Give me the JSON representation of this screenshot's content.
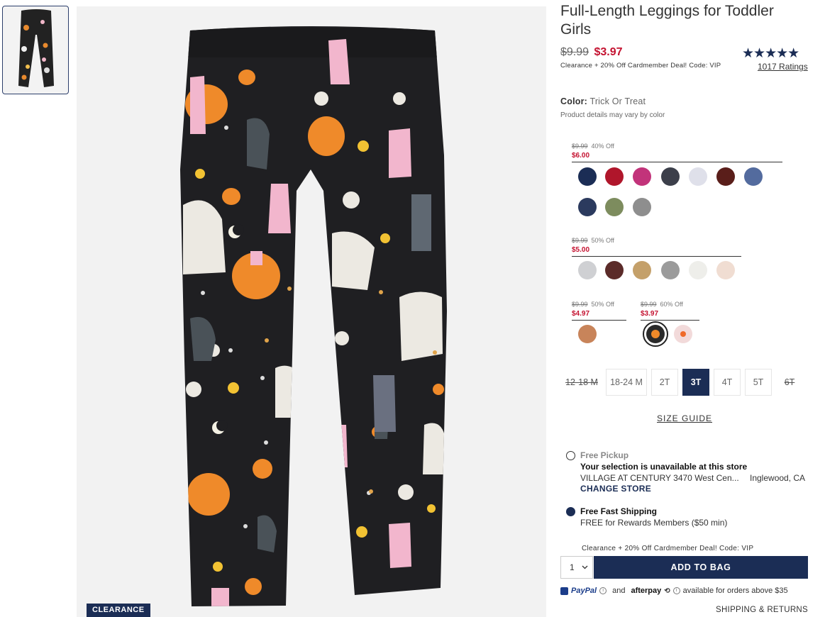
{
  "product": {
    "title": "Full-Length Leggings for Toddler Girls",
    "price_old": "$9.99",
    "price_new": "$3.97",
    "deal_note": "Clearance + 20% Off Cardmember Deal! Code: VIP",
    "stars": "★★★★★",
    "ratings": "1017 Ratings",
    "badge": "CLEARANCE"
  },
  "color": {
    "label": "Color:",
    "value": "Trick Or Treat",
    "vary_note": "Product details may vary by color"
  },
  "price_groups": [
    {
      "old": "$9.99",
      "off": "40% Off",
      "new": "$6.00",
      "swatches": [
        "#1b2d55",
        "#b0162b",
        "#c2337a",
        "#3c3f4a",
        "#dfe0ea",
        "#5a1e1a",
        "#536b9e",
        "#2b3a5e",
        "#7d8c5e",
        "#8e8e8e"
      ]
    },
    {
      "old": "$9.99",
      "off": "50% Off",
      "new": "$5.00",
      "swatches": [
        "#cfd0d3",
        "#5b2b29",
        "#c4a06a",
        "#9b9b9b",
        "#eeeeea",
        "#f0ddd2"
      ]
    },
    {
      "old": "$9.99",
      "off": "50% Off",
      "new": "$4.97",
      "swatches": [
        "#c8845a"
      ]
    },
    {
      "old": "$9.99",
      "off": "60% Off",
      "new": "$3.97",
      "swatches": [
        "#2a2a2a",
        "#f2dada"
      ]
    }
  ],
  "sizes": [
    {
      "label": "12-18 M",
      "state": "na"
    },
    {
      "label": "18-24 M",
      "state": "avail"
    },
    {
      "label": "2T",
      "state": "avail"
    },
    {
      "label": "3T",
      "state": "selected"
    },
    {
      "label": "4T",
      "state": "avail"
    },
    {
      "label": "5T",
      "state": "avail"
    },
    {
      "label": "6T",
      "state": "na"
    }
  ],
  "size_guide": "SIZE GUIDE",
  "pickup": {
    "title": "Free Pickup",
    "unavailable": "Your selection is unavailable at this store",
    "store": "VILLAGE AT CENTURY 3470 West Cen...",
    "city": "Inglewood, CA",
    "change": "CHANGE STORE"
  },
  "shipping": {
    "title": "Free Fast Shipping",
    "sub": "FREE for Rewards Members ($50 min)"
  },
  "cart": {
    "deal": "Clearance + 20% Off Cardmember Deal! Code: VIP",
    "qty": "1",
    "add_label": "ADD TO BAG"
  },
  "payments": {
    "paypal": "PayPal",
    "and": "and",
    "afterpay": "afterpay",
    "note": "available for orders above $35"
  },
  "shipping_returns": "SHIPPING & RETURNS",
  "icons": {
    "qty_caret": "chevron-down-icon",
    "info": "info-icon"
  }
}
